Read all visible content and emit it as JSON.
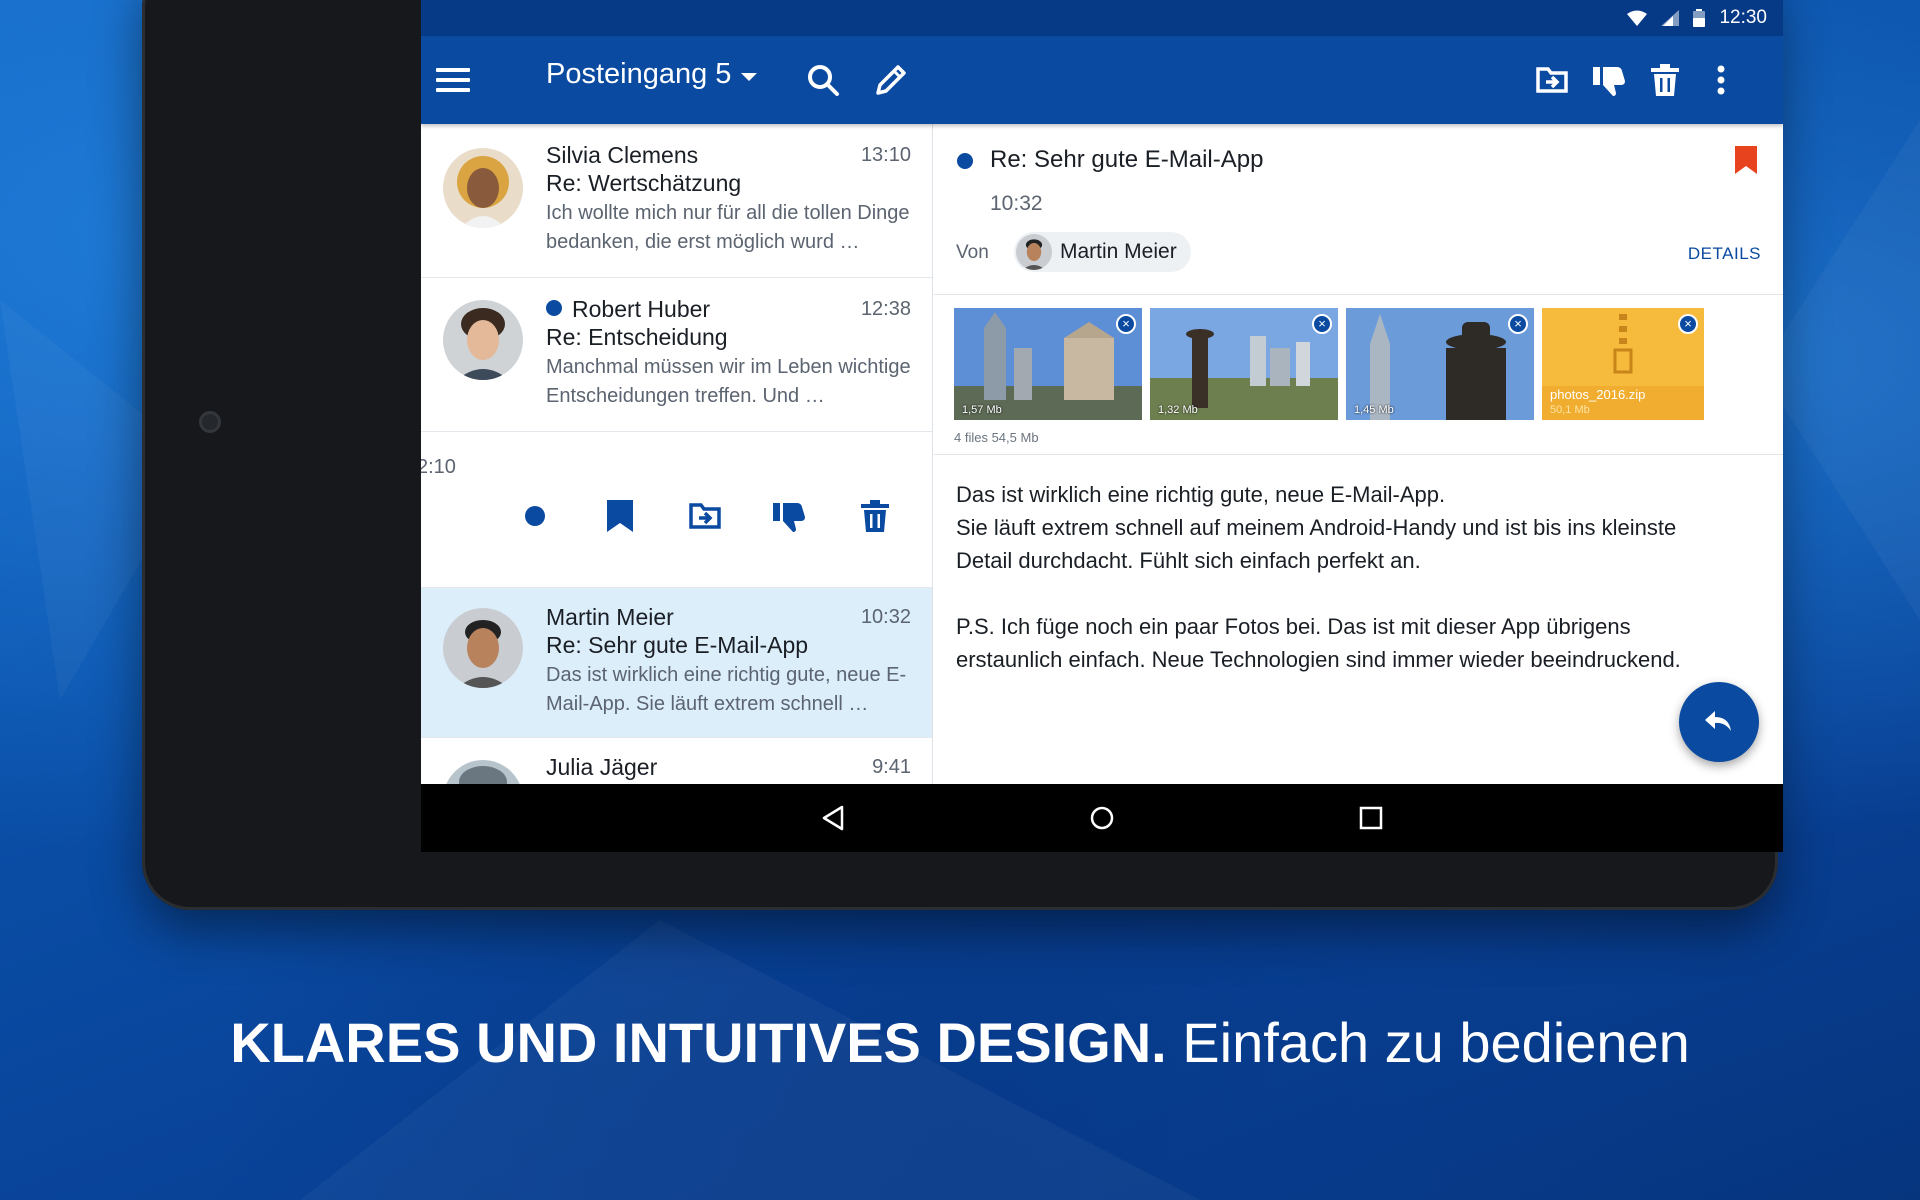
{
  "status": {
    "time": "12:30"
  },
  "appbar": {
    "folder_label": "Posteingang 5"
  },
  "messages": [
    {
      "sender": "Silvia Clemens",
      "time": "13:10",
      "subject": "Re: Wertschätzung",
      "preview": "Ich wollte mich nur für all die tollen Dinge bedanken, die erst möglich wurd …",
      "unread": false
    },
    {
      "sender": "Robert Huber",
      "time": "12:38",
      "subject": "Re: Entscheidung",
      "preview": "Manchmal müssen wir im Leben wichtige Entscheidungen treffen. Und …",
      "unread": true
    },
    {
      "sender": "Martin Meier",
      "time": "10:32",
      "subject": "Re: Sehr gute E-Mail-App",
      "preview": "Das ist wirklich eine richtig gute, neue E-Mail-App. Sie läuft extrem schnell …",
      "unread": false
    },
    {
      "sender": "Julia Jäger",
      "time": "9:41"
    }
  ],
  "swiped_row": {
    "time_fragment": "2:10"
  },
  "detail": {
    "subject": "Re: Sehr gute E-Mail-App",
    "time": "10:32",
    "from_label": "Von",
    "from_name": "Martin Meier",
    "details_label": "DETAILS",
    "attachments": [
      {
        "size": "1,57 Mb"
      },
      {
        "size": "1,32 Mb"
      },
      {
        "size": "1,45 Mb"
      },
      {
        "name": "photos_2016.zip",
        "size": "50,1 Mb"
      }
    ],
    "files_total": "4 files 54,5 Mb",
    "body_lines": [
      "Das ist wirklich eine richtig gute, neue E-Mail-App.",
      "Sie läuft extrem schnell auf meinem Android-Handy und ist bis ins kleinste",
      "Detail durchdacht. Fühlt sich einfach perfekt an.",
      "",
      "P.S. Ich füge noch ein paar Fotos bei. Das ist mit dieser App übrigens",
      "erstaunlich einfach. Neue Technologien sind immer wieder beeindruckend."
    ]
  },
  "tagline": {
    "bold": "KLARES UND INTUITIVES DESIGN.",
    "light": "Einfach zu bedienen"
  },
  "colors": {
    "primary": "#0a4aa0",
    "bookmark": "#e8431f",
    "selected_row": "#ddeefb"
  }
}
